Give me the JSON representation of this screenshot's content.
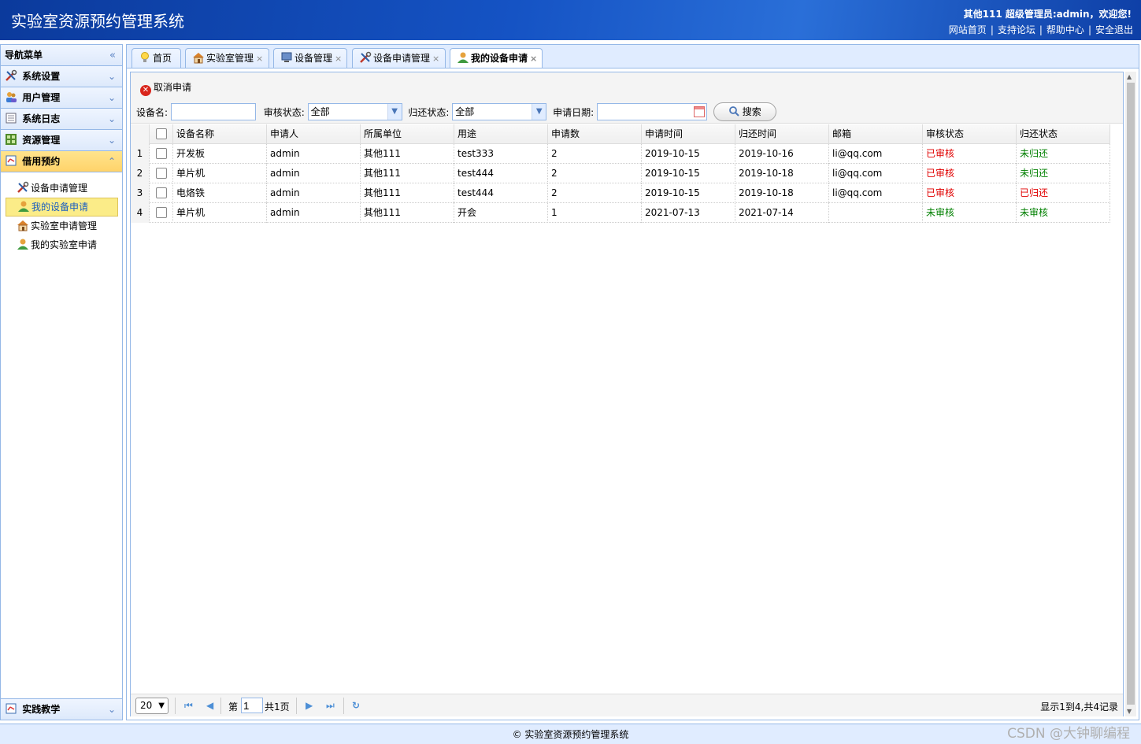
{
  "header": {
    "title": "实验室资源预约管理系统",
    "welcome": "其他111 超级管理员:admin，欢迎您!",
    "links": [
      "网站首页",
      "支持论坛",
      "帮助中心",
      "安全退出"
    ]
  },
  "sidebar": {
    "title": "导航菜单",
    "sections": [
      {
        "label": "系统设置",
        "icon": "tools-icon"
      },
      {
        "label": "用户管理",
        "icon": "users-icon"
      },
      {
        "label": "系统日志",
        "icon": "log-icon"
      },
      {
        "label": "资源管理",
        "icon": "grid-icon"
      },
      {
        "label": "借用预约",
        "icon": "book-icon"
      }
    ],
    "sub_items": [
      {
        "label": "设备申请管理",
        "icon": "tools-icon"
      },
      {
        "label": "我的设备申请",
        "icon": "user-icon"
      },
      {
        "label": "实验室申请管理",
        "icon": "home-icon"
      },
      {
        "label": "我的实验室申请",
        "icon": "user-icon"
      }
    ],
    "bottom_section": {
      "label": "实践教学",
      "icon": "chart-icon"
    }
  },
  "tabs": [
    "首页",
    "实验室管理",
    "设备管理",
    "设备申请管理",
    "我的设备申请"
  ],
  "toolbar": {
    "cancel_label": "取消申请",
    "device_label": "设备名:",
    "device_value": "",
    "audit_label": "审核状态:",
    "audit_value": "全部",
    "return_label": "归还状态:",
    "return_value": "全部",
    "date_label": "申请日期:",
    "date_value": "",
    "search_label": "搜索"
  },
  "grid": {
    "columns": [
      "设备名称",
      "申请人",
      "所属单位",
      "用途",
      "申请数",
      "申请时间",
      "归还时间",
      "邮箱",
      "审核状态",
      "归还状态"
    ],
    "rows": [
      {
        "num": "1",
        "name": "开发板",
        "applicant": "admin",
        "unit": "其他111",
        "purpose": "test333",
        "count": "2",
        "apply_time": "2019-10-15",
        "return_time": "2019-10-16",
        "email": "li@qq.com",
        "audit": "已审核",
        "return": "未归还"
      },
      {
        "num": "2",
        "name": "单片机",
        "applicant": "admin",
        "unit": "其他111",
        "purpose": "test444",
        "count": "2",
        "apply_time": "2019-10-15",
        "return_time": "2019-10-18",
        "email": "li@qq.com",
        "audit": "已审核",
        "return": "未归还"
      },
      {
        "num": "3",
        "name": "电烙铁",
        "applicant": "admin",
        "unit": "其他111",
        "purpose": "test444",
        "count": "2",
        "apply_time": "2019-10-15",
        "return_time": "2019-10-18",
        "email": "li@qq.com",
        "audit": "已审核",
        "return": "已归还"
      },
      {
        "num": "4",
        "name": "单片机",
        "applicant": "admin",
        "unit": "其他111",
        "purpose": "开会",
        "count": "1",
        "apply_time": "2021-07-13",
        "return_time": "2021-07-14",
        "email": "",
        "audit": "未审核",
        "return": "未审核"
      }
    ]
  },
  "pager": {
    "page_size": "20",
    "page_prefix": "第",
    "page_value": "1",
    "page_total": "共1页",
    "info": "显示1到4,共4记录"
  },
  "footer": "© 实验室资源预约管理系统",
  "watermark": "CSDN @大钟聊编程",
  "colors": {
    "header_blue": "#1553c4",
    "border": "#95b8e7",
    "status_red": "#e00000",
    "status_green": "#008000",
    "selected": "#fbec88"
  }
}
